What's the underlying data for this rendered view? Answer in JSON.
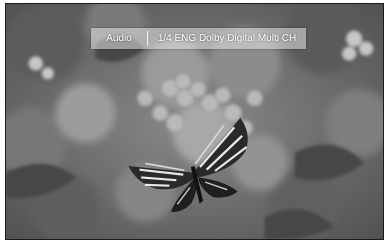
{
  "osd": {
    "label": "Audio",
    "value": "1/4 ENG Dolby Digital Multi CH"
  },
  "colors": {
    "frame_border": "#1c1c1c",
    "osd_text": "#ffffff",
    "osd_background": "#e6e6e6"
  },
  "icons": {
    "background": "butterfly-on-flowers-photo"
  }
}
